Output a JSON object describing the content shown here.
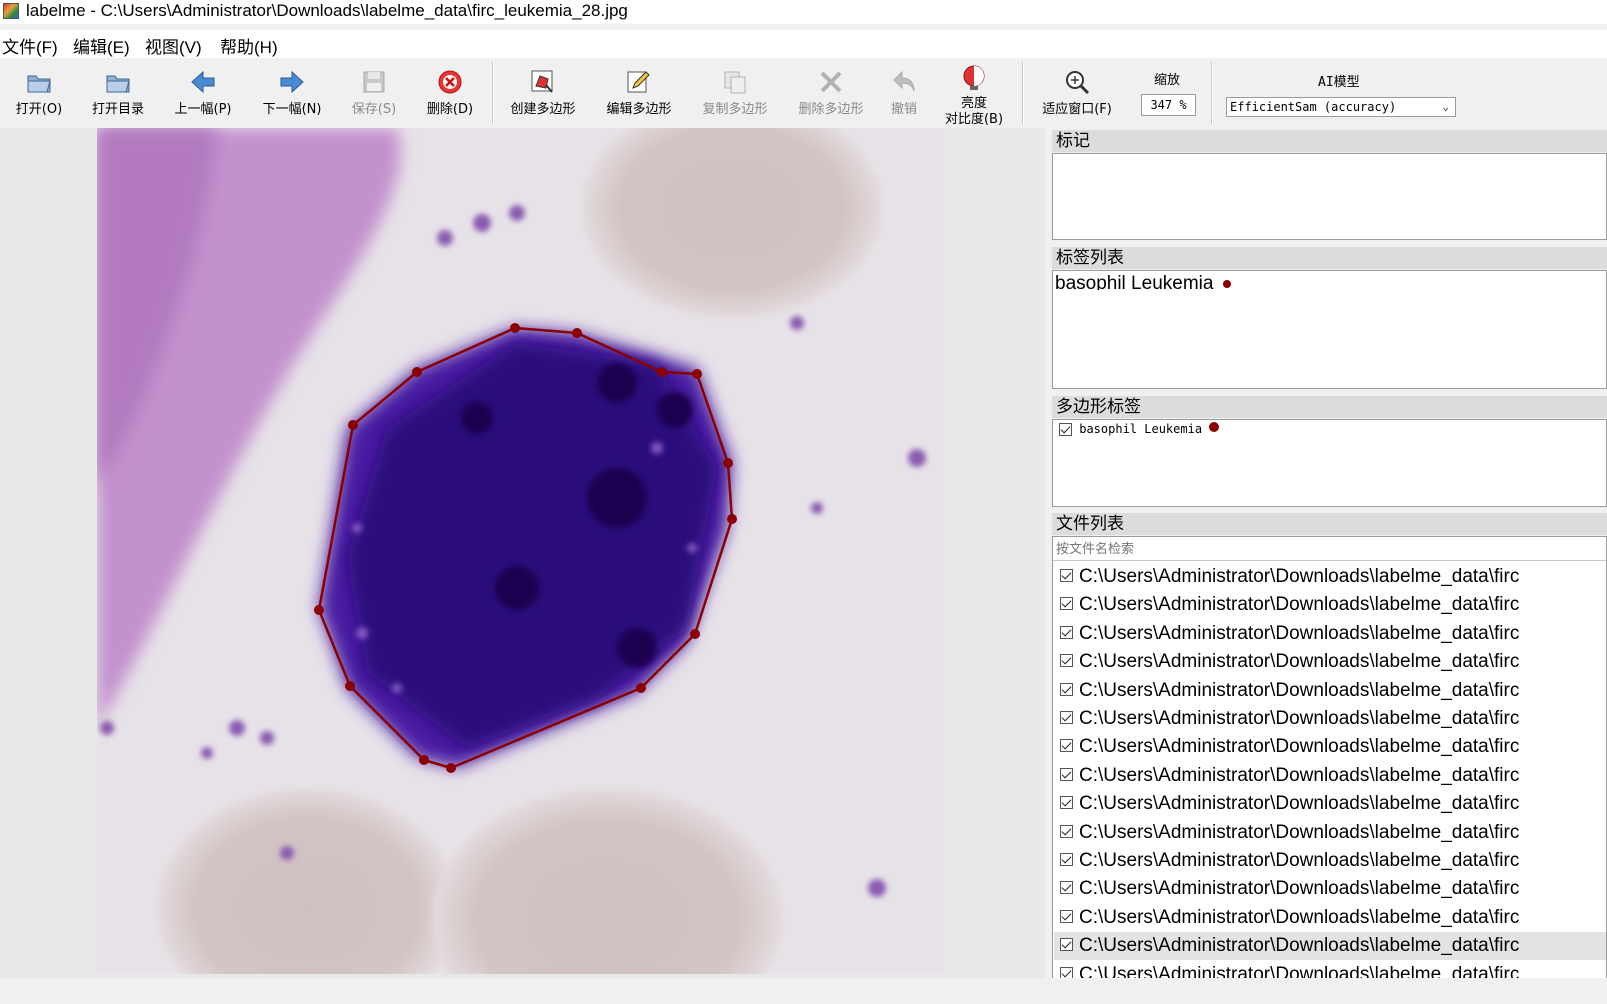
{
  "window": {
    "title": "labelme - C:\\Users\\Administrator\\Downloads\\labelme_data\\firc_leukemia_28.jpg"
  },
  "menubar": [
    {
      "label": "文件(F)"
    },
    {
      "label": "编辑(E)"
    },
    {
      "label": "视图(V)"
    },
    {
      "label": "帮助(H)"
    }
  ],
  "toolbar": {
    "open": "打开(O)",
    "open_dir": "打开目录",
    "prev": "上一幅(P)",
    "next": "下一幅(N)",
    "save": "保存(S)",
    "delete": "删除(D)",
    "create_polygon": "创建多边形",
    "edit_polygon": "编辑多边形",
    "copy_polygon": "复制多边形",
    "delete_polygon": "删除多边形",
    "undo": "撤销",
    "brightness_l1": "亮度",
    "brightness_l2": "对比度(B)",
    "fit_window": "适应窗口(F)",
    "zoom_caption": "缩放",
    "zoom_value": "347 %",
    "ai_caption": "AI模型",
    "ai_model": "EfficientSam (accuracy)"
  },
  "colors": {
    "polygon": "#8b0000",
    "label_dot": "#8b0000"
  },
  "docks": {
    "flags": {
      "title": "标记"
    },
    "label_list": {
      "title": "标签列表",
      "items": [
        {
          "label": "basophil Leukemia"
        }
      ]
    },
    "polygon_labels": {
      "title": "多边形标签",
      "items": [
        {
          "label": "basophil Leukemia",
          "checked": true
        }
      ]
    },
    "file_list": {
      "title": "文件列表",
      "search_placeholder": "按文件名检索",
      "items": [
        "C:\\Users\\Administrator\\Downloads\\labelme_data\\firc",
        "C:\\Users\\Administrator\\Downloads\\labelme_data\\firc",
        "C:\\Users\\Administrator\\Downloads\\labelme_data\\firc",
        "C:\\Users\\Administrator\\Downloads\\labelme_data\\firc",
        "C:\\Users\\Administrator\\Downloads\\labelme_data\\firc",
        "C:\\Users\\Administrator\\Downloads\\labelme_data\\firc",
        "C:\\Users\\Administrator\\Downloads\\labelme_data\\firc",
        "C:\\Users\\Administrator\\Downloads\\labelme_data\\firc",
        "C:\\Users\\Administrator\\Downloads\\labelme_data\\firc",
        "C:\\Users\\Administrator\\Downloads\\labelme_data\\firc",
        "C:\\Users\\Administrator\\Downloads\\labelme_data\\firc",
        "C:\\Users\\Administrator\\Downloads\\labelme_data\\firc",
        "C:\\Users\\Administrator\\Downloads\\labelme_data\\firc",
        "C:\\Users\\Administrator\\Downloads\\labelme_data\\firc",
        "C:\\Users\\Administrator\\Downloads\\labelme_data\\firc"
      ],
      "selected_index": 13
    }
  }
}
